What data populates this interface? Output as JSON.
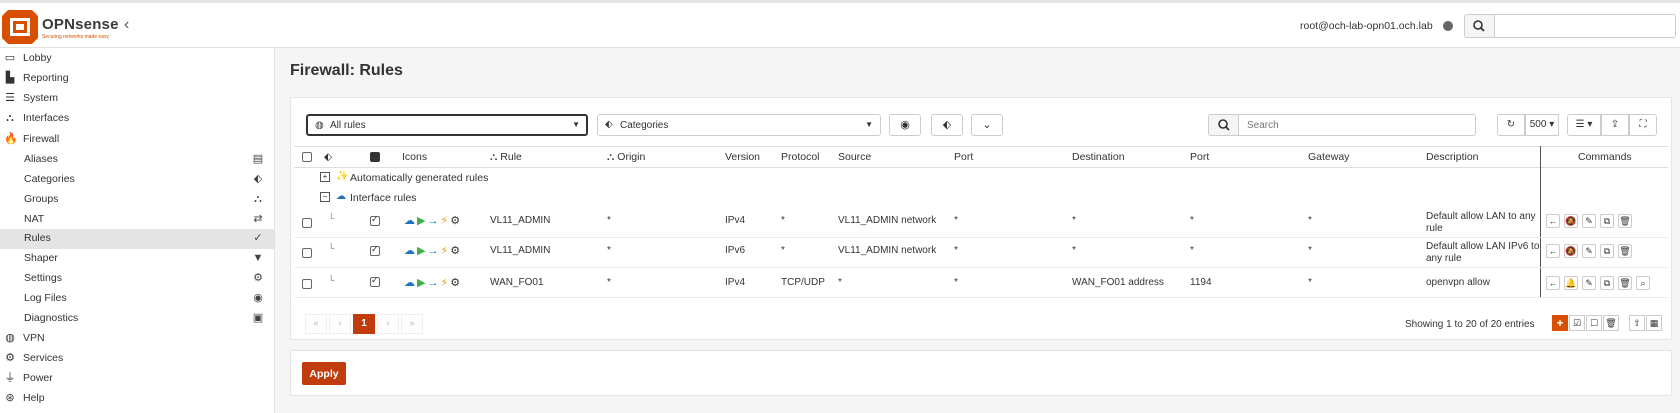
{
  "header": {
    "brand_name": "OPNsense",
    "brand_tagline": "Securing networks made easy",
    "user": "root@och-lab-opn01.och.lab",
    "search_placeholder": ""
  },
  "sidebar": {
    "items": [
      {
        "label": "Lobby",
        "icon": "laptop-icon"
      },
      {
        "label": "Reporting",
        "icon": "area-chart-icon"
      },
      {
        "label": "System",
        "icon": "server-icon"
      },
      {
        "label": "Interfaces",
        "icon": "sitemap-icon"
      },
      {
        "label": "Firewall",
        "icon": "fire-icon"
      }
    ],
    "firewall_sub": [
      {
        "label": "Aliases",
        "icon": "list-alt-icon"
      },
      {
        "label": "Categories",
        "icon": "tags-icon"
      },
      {
        "label": "Groups",
        "icon": "sitemap-icon"
      },
      {
        "label": "NAT",
        "icon": "exchange-icon"
      },
      {
        "label": "Rules",
        "icon": "check-icon"
      },
      {
        "label": "Shaper",
        "icon": "filter-icon"
      },
      {
        "label": "Settings",
        "icon": "cogs-icon"
      },
      {
        "label": "Log Files",
        "icon": "eye-icon"
      },
      {
        "label": "Diagnostics",
        "icon": "medkit-icon"
      }
    ],
    "items_after": [
      {
        "label": "VPN",
        "icon": "globe-icon"
      },
      {
        "label": "Services",
        "icon": "cog-icon"
      },
      {
        "label": "Power",
        "icon": "plug-icon"
      },
      {
        "label": "Help",
        "icon": "support-icon"
      }
    ]
  },
  "page": {
    "title": "Firewall: Rules"
  },
  "toolbar": {
    "rules_filter": "All rules",
    "categories_placeholder": "Categories",
    "search_placeholder": "Search",
    "page_size": "500"
  },
  "table": {
    "headers": {
      "icons": "Icons",
      "rule": "Rule",
      "origin": "Origin",
      "version": "Version",
      "protocol": "Protocol",
      "source": "Source",
      "src_port": "Port",
      "destination": "Destination",
      "dst_port": "Port",
      "gateway": "Gateway",
      "description": "Description",
      "commands": "Commands"
    },
    "groups": {
      "auto": "Automatically generated rules",
      "interface": "Interface rules"
    },
    "rows": [
      {
        "rule": "VL11_ADMIN",
        "origin": "*",
        "version": "IPv4",
        "protocol": "*",
        "source": "VL11_ADMIN network",
        "src_port": "*",
        "destination": "*",
        "dst_port": "*",
        "gateway": "*",
        "description": "Default allow LAN to any rule"
      },
      {
        "rule": "VL11_ADMIN",
        "origin": "*",
        "version": "IPv6",
        "protocol": "*",
        "source": "VL11_ADMIN network",
        "src_port": "*",
        "destination": "*",
        "dst_port": "*",
        "gateway": "*",
        "description": "Default allow LAN IPv6 to any rule"
      },
      {
        "rule": "WAN_FO01",
        "origin": "*",
        "version": "IPv4",
        "protocol": "TCP/UDP",
        "source": "*",
        "src_port": "*",
        "destination": "WAN_FO01 address",
        "dst_port": "1194",
        "gateway": "*",
        "description": "openvpn allow"
      }
    ]
  },
  "pagination": {
    "first": "«",
    "prev": "‹",
    "current": "1",
    "next": "›",
    "last": "»",
    "showing": "Showing 1 to 20 of 20 entries"
  },
  "apply_label": "Apply",
  "colors": {
    "brand": "#d94f00",
    "apply": "#c03c0c"
  }
}
